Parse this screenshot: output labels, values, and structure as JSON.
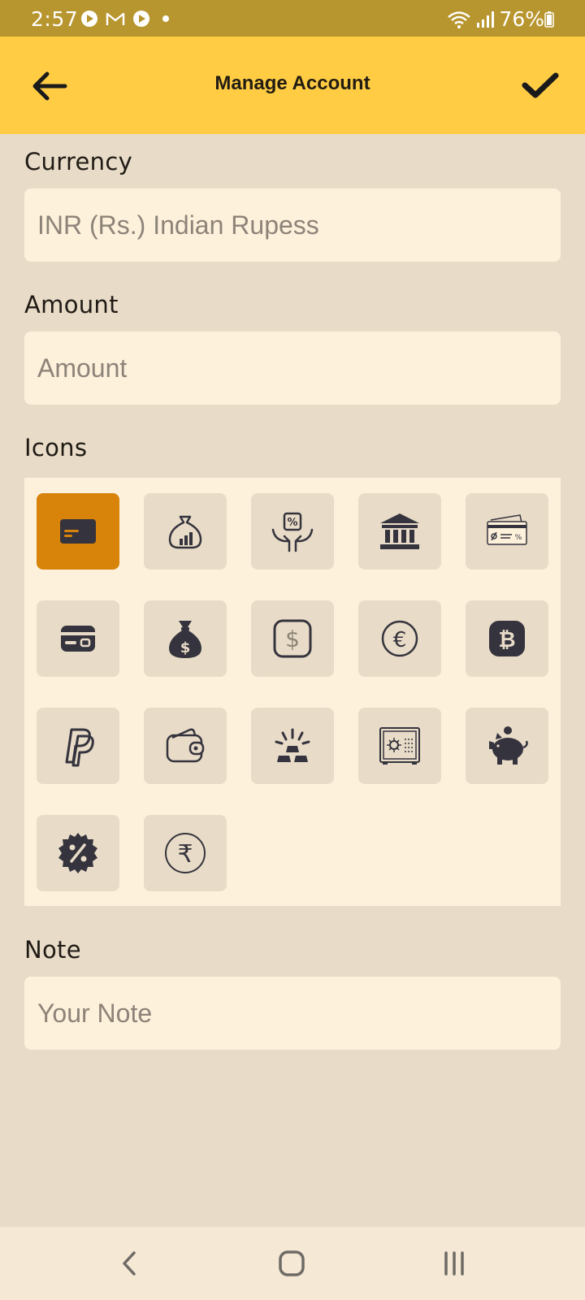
{
  "status": {
    "time": "2:57",
    "battery": "76%",
    "icons": [
      "play-icon",
      "gmail-icon",
      "play-icon",
      "dot-icon",
      "wifi-icon",
      "signal-icon",
      "battery-icon"
    ]
  },
  "app_bar": {
    "title": "Manage Account",
    "back_icon": "arrow-left-icon",
    "confirm_icon": "checkmark-icon"
  },
  "currency": {
    "label": "Currency",
    "value": "",
    "placeholder": "INR (Rs.) Indian Rupess"
  },
  "amount": {
    "label": "Amount",
    "value": "",
    "placeholder": "Amount"
  },
  "icons": {
    "label": "Icons",
    "selected": "credit-card-icon",
    "items": [
      "credit-card-icon",
      "money-bag-chart-icon",
      "percent-hands-icon",
      "bank-icon",
      "cheque-icon",
      "card-icon",
      "dollar-bag-icon",
      "dollar-square-icon",
      "euro-icon",
      "bitcoin-icon",
      "paypal-icon",
      "wallet-icon",
      "gold-bars-icon",
      "safe-icon",
      "piggy-bank-icon",
      "percent-badge-icon",
      "rupee-icon"
    ]
  },
  "note": {
    "label": "Note",
    "value": "",
    "placeholder": "Your Note"
  },
  "nav": {
    "buttons": [
      "nav-back-icon",
      "nav-home-icon",
      "nav-recents-icon"
    ]
  },
  "colors": {
    "status_bar": "#b8962f",
    "app_bar": "#ffcc44",
    "background": "#e8dcc8",
    "input_bg": "#fdf1dc",
    "selected_tile": "#d8830a",
    "icon_dark": "#35333d"
  }
}
